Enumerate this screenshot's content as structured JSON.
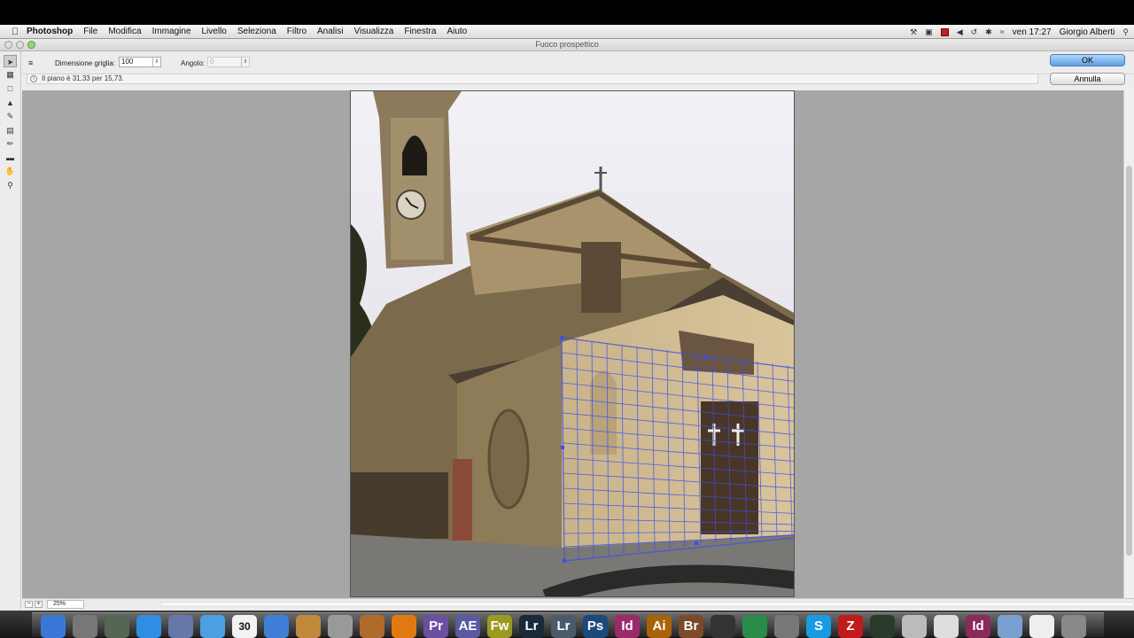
{
  "menubar": {
    "app_name": "Photoshop",
    "items": [
      "File",
      "Modifica",
      "Immagine",
      "Livello",
      "Seleziona",
      "Filtro",
      "Analisi",
      "Visualizza",
      "Finestra",
      "Aiuto"
    ],
    "clock": "ven 17:27",
    "user": "Giorgio Alberti"
  },
  "window": {
    "title": "Fuoco prospettico"
  },
  "options": {
    "grid_size_label": "Dimensione griglia:",
    "grid_size_value": "100",
    "angle_label": "Angolo:",
    "angle_value": "0"
  },
  "buttons": {
    "ok": "OK",
    "cancel": "Annulla"
  },
  "info": {
    "message": "Il piano è 31,33 per 15,73."
  },
  "status": {
    "zoom": "25%"
  },
  "tools": [
    "edit-plane-tool",
    "create-plane-tool",
    "marquee-tool",
    "stamp-tool",
    "brush-tool",
    "transform-tool",
    "eyedropper-tool",
    "measure-tool",
    "hand-tool",
    "zoom-tool"
  ],
  "dock": {
    "apps": [
      {
        "name": "Finder",
        "label": "",
        "color": "#3a78d8"
      },
      {
        "name": "Launchpad",
        "label": "",
        "color": "#777777"
      },
      {
        "name": "Mission Control",
        "label": "",
        "color": "#556655"
      },
      {
        "name": "App Store",
        "label": "",
        "color": "#2f8de4"
      },
      {
        "name": "Preview",
        "label": "",
        "color": "#6677aa"
      },
      {
        "name": "Safari",
        "label": "",
        "color": "#4aa0e0"
      },
      {
        "name": "Calendar",
        "label": "30",
        "color": "#f2f2f2"
      },
      {
        "name": "iTunes",
        "label": "",
        "color": "#3f7fd8"
      },
      {
        "name": "Photo Viewer",
        "label": "",
        "color": "#c08a3a"
      },
      {
        "name": "Automator",
        "label": "",
        "color": "#999999"
      },
      {
        "name": "Guitar",
        "label": "",
        "color": "#b06a2a"
      },
      {
        "name": "VLC",
        "label": "",
        "color": "#e07a10"
      },
      {
        "name": "Premiere",
        "label": "Pr",
        "color": "#6b4fa0"
      },
      {
        "name": "After Effects",
        "label": "AE",
        "color": "#5a5aa0"
      },
      {
        "name": "Fireworks",
        "label": "Fw",
        "color": "#9a9a20"
      },
      {
        "name": "Lightroom",
        "label": "Lr",
        "color": "#1a2a3a"
      },
      {
        "name": "Lightroom 2",
        "label": "Lr",
        "color": "#4a5a6a"
      },
      {
        "name": "Photoshop",
        "label": "Ps",
        "color": "#1a4a7a"
      },
      {
        "name": "InDesign",
        "label": "Id",
        "color": "#9a2a6a"
      },
      {
        "name": "Illustrator",
        "label": "Ai",
        "color": "#a8620a"
      },
      {
        "name": "Bridge",
        "label": "Br",
        "color": "#7a4a2a"
      },
      {
        "name": "Aperture",
        "label": "",
        "color": "#333333"
      },
      {
        "name": "Money",
        "label": "",
        "color": "#2a8a4a"
      },
      {
        "name": "System Preferences",
        "label": "",
        "color": "#777777"
      },
      {
        "name": "Skype",
        "label": "S",
        "color": "#1a9ae0"
      },
      {
        "name": "FileZilla",
        "label": "Z",
        "color": "#c01a1a"
      },
      {
        "name": "Activity Monitor",
        "label": "",
        "color": "#2a3a2a"
      },
      {
        "name": "Disk Utility",
        "label": "",
        "color": "#bbbbbb"
      },
      {
        "name": "TextEdit",
        "label": "",
        "color": "#dddddd"
      },
      {
        "name": "InDesign 2",
        "label": "Id",
        "color": "#8a2a5a"
      },
      {
        "name": "Folder",
        "label": "",
        "color": "#7aa0d0"
      },
      {
        "name": "Document",
        "label": "",
        "color": "#eeeeee"
      },
      {
        "name": "Trash",
        "label": "",
        "color": "#888888"
      }
    ]
  }
}
